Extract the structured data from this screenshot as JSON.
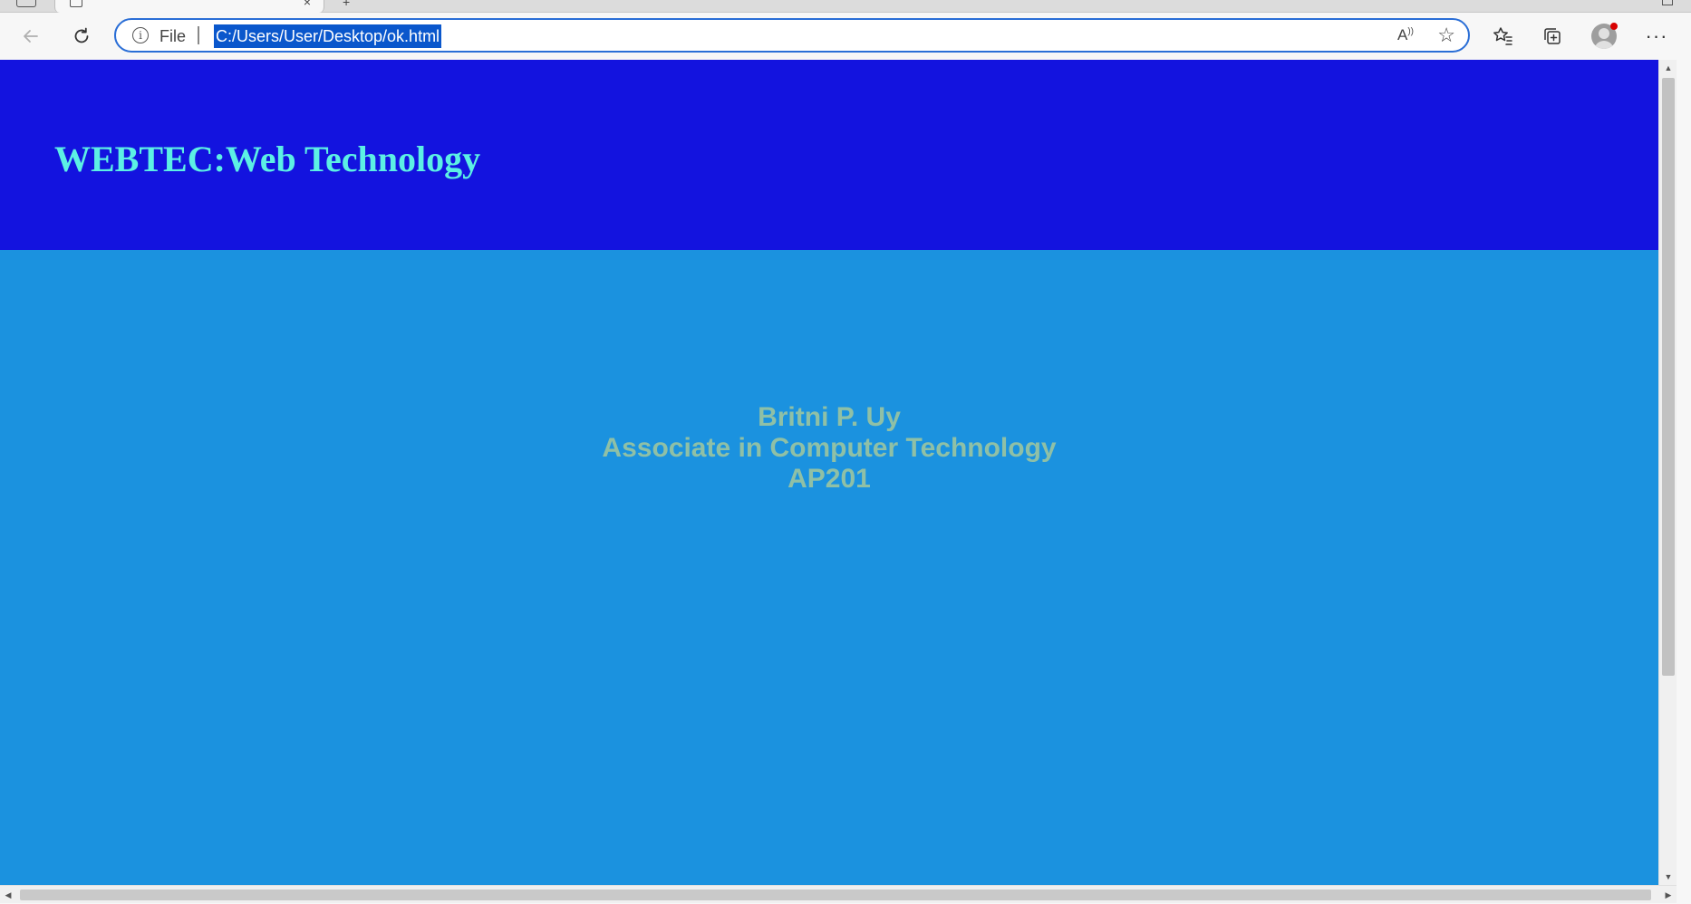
{
  "browser": {
    "tab": {
      "close_glyph": "×",
      "new_tab_glyph": "+"
    },
    "toolbar": {
      "back_icon": "arrow-left",
      "reload_icon": "reload",
      "favorites_icon": "star-list",
      "collections_icon": "collections",
      "profile_icon": "avatar",
      "more_label": "···"
    },
    "address_bar": {
      "scheme_label": "File",
      "url": "C:/Users/User/Desktop/ok.html",
      "read_aloud_label": "A⁾",
      "add_favorite_icon": "star-plus"
    }
  },
  "page": {
    "header": {
      "title": "WEBTEC:Web Technology",
      "background": "#1313df",
      "title_color": "#5cf0e4"
    },
    "body": {
      "background": "#1b92df",
      "text_color": "#8fc0a6",
      "lines": [
        "Britni P. Uy",
        "Associate in Computer Technology",
        "AP201"
      ]
    }
  },
  "scrollbars": {
    "up_arrow": "▲",
    "down_arrow": "▼",
    "left_arrow": "◀",
    "right_arrow": "▶"
  }
}
